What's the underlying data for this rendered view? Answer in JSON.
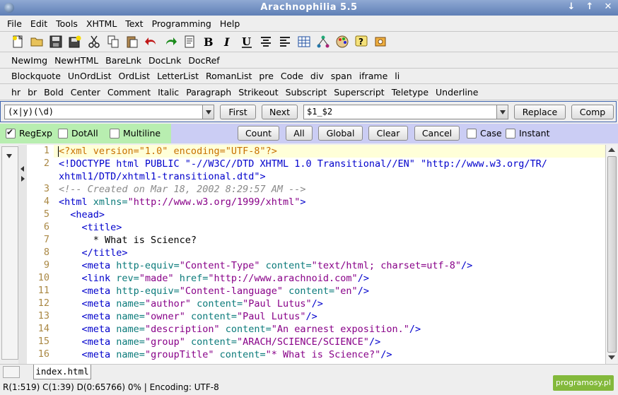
{
  "window": {
    "title": "Arachnophilia 5.5",
    "buttons": [
      "↓",
      "↑",
      "✕"
    ]
  },
  "menu": [
    "File",
    "Edit",
    "Tools",
    "XHTML",
    "Text",
    "Programming",
    "Help"
  ],
  "toolbar_icons": [
    "new-file-icon",
    "open-folder-icon",
    "save-icon",
    "save-all-icon",
    "cut-icon",
    "copy-icon",
    "paste-icon",
    "undo-icon",
    "redo-icon",
    "document-icon",
    "bold-icon",
    "italic-icon",
    "underline-icon",
    "center-align-icon",
    "format-icon",
    "table-icon",
    "tree-icon",
    "palette-icon",
    "help-icon",
    "preferences-icon"
  ],
  "tagbar1": [
    "NewImg",
    "NewHTML",
    "BareLnk",
    "DocLnk",
    "DocRef"
  ],
  "tagbar2": [
    "Blockquote",
    "UnOrdList",
    "OrdList",
    "LetterList",
    "RomanList",
    "pre",
    "Code",
    "div",
    "span",
    "iframe",
    "li"
  ],
  "tagbar3": [
    "hr",
    "br",
    "Bold",
    "Center",
    "Comment",
    "Italic",
    "Paragraph",
    "Strikeout",
    "Subscript",
    "Superscript",
    "Teletype",
    "Underline"
  ],
  "search": {
    "find_value": "(x|y)(\\d)",
    "first_label": "First",
    "next_label": "Next",
    "replace_value": "$1_$2",
    "replace_label": "Replace",
    "comp_label": "Comp"
  },
  "options": {
    "regexp": {
      "label": "RegExp",
      "checked": true
    },
    "dotall": {
      "label": "DotAll",
      "checked": false
    },
    "multiline": {
      "label": "Multiline",
      "checked": false
    },
    "count_label": "Count",
    "all_label": "All",
    "global_label": "Global",
    "clear_label": "Clear",
    "cancel_label": "Cancel",
    "case": {
      "label": "Case",
      "checked": false
    },
    "instant": {
      "label": "Instant",
      "checked": false
    }
  },
  "editor": {
    "line_numbers": [
      "1",
      "2",
      "",
      "3",
      "4",
      "5",
      "6",
      "7",
      "8",
      "9",
      "10",
      "11",
      "12",
      "13",
      "14",
      "15",
      "16"
    ],
    "lines": [
      [
        [
          "pi",
          "<?xml version=\"1.0\" encoding=\"UTF-8\"?>"
        ]
      ],
      [
        [
          "tg",
          "<!DOCTYPE html PUBLIC \"-//W3C//DTD XHTML 1.0 Transitional//EN\" \"http://www.w3.org/TR/"
        ]
      ],
      [
        [
          "tg",
          "xhtml1/DTD/xhtml1-transitional.dtd\">"
        ]
      ],
      [
        [
          "cm",
          "<!-- Created on Mar 18, 2002 8:29:57 AM -->"
        ]
      ],
      [
        [
          "tg",
          "<html "
        ],
        [
          "at",
          "xmlns="
        ],
        [
          "vl",
          "\"http://www.w3.org/1999/xhtml\""
        ],
        [
          "tg",
          ">"
        ]
      ],
      [
        [
          "tx",
          "  "
        ],
        [
          "tg",
          "<head>"
        ]
      ],
      [
        [
          "tx",
          "    "
        ],
        [
          "tg",
          "<title>"
        ]
      ],
      [
        [
          "tx",
          "      * What is Science?"
        ]
      ],
      [
        [
          "tx",
          "    "
        ],
        [
          "tg",
          "</title>"
        ]
      ],
      [
        [
          "tx",
          "    "
        ],
        [
          "tg",
          "<meta "
        ],
        [
          "at",
          "http-equiv="
        ],
        [
          "vl",
          "\"Content-Type\" "
        ],
        [
          "at",
          "content="
        ],
        [
          "vl",
          "\"text/html; charset=utf-8\""
        ],
        [
          "tg",
          "/>"
        ]
      ],
      [
        [
          "tx",
          "    "
        ],
        [
          "tg",
          "<link "
        ],
        [
          "at",
          "rev="
        ],
        [
          "vl",
          "\"made\" "
        ],
        [
          "at",
          "href="
        ],
        [
          "vl",
          "\"http://www.arachnoid.com\""
        ],
        [
          "tg",
          "/>"
        ]
      ],
      [
        [
          "tx",
          "    "
        ],
        [
          "tg",
          "<meta "
        ],
        [
          "at",
          "http-equiv="
        ],
        [
          "vl",
          "\"Content-language\" "
        ],
        [
          "at",
          "content="
        ],
        [
          "vl",
          "\"en\""
        ],
        [
          "tg",
          "/>"
        ]
      ],
      [
        [
          "tx",
          "    "
        ],
        [
          "tg",
          "<meta "
        ],
        [
          "at",
          "name="
        ],
        [
          "vl",
          "\"author\" "
        ],
        [
          "at",
          "content="
        ],
        [
          "vl",
          "\"Paul Lutus\""
        ],
        [
          "tg",
          "/>"
        ]
      ],
      [
        [
          "tx",
          "    "
        ],
        [
          "tg",
          "<meta "
        ],
        [
          "at",
          "name="
        ],
        [
          "vl",
          "\"owner\" "
        ],
        [
          "at",
          "content="
        ],
        [
          "vl",
          "\"Paul Lutus\""
        ],
        [
          "tg",
          "/>"
        ]
      ],
      [
        [
          "tx",
          "    "
        ],
        [
          "tg",
          "<meta "
        ],
        [
          "at",
          "name="
        ],
        [
          "vl",
          "\"description\" "
        ],
        [
          "at",
          "content="
        ],
        [
          "vl",
          "\"An earnest exposition.\""
        ],
        [
          "tg",
          "/>"
        ]
      ],
      [
        [
          "tx",
          "    "
        ],
        [
          "tg",
          "<meta "
        ],
        [
          "at",
          "name="
        ],
        [
          "vl",
          "\"group\" "
        ],
        [
          "at",
          "content="
        ],
        [
          "vl",
          "\"ARACH/SCIENCE/SCIENCE\""
        ],
        [
          "tg",
          "/>"
        ]
      ],
      [
        [
          "tx",
          "    "
        ],
        [
          "tg",
          "<meta "
        ],
        [
          "at",
          "name="
        ],
        [
          "vl",
          "\"groupTitle\" "
        ],
        [
          "at",
          "content="
        ],
        [
          "vl",
          "\"* What is Science?\""
        ],
        [
          "tg",
          "/>"
        ]
      ]
    ]
  },
  "tab": {
    "label": "index.html"
  },
  "status": "R(1:519) C(1:39) D(0:65766) 0% | Encoding: UTF-8",
  "watermark": "programosy.pl"
}
